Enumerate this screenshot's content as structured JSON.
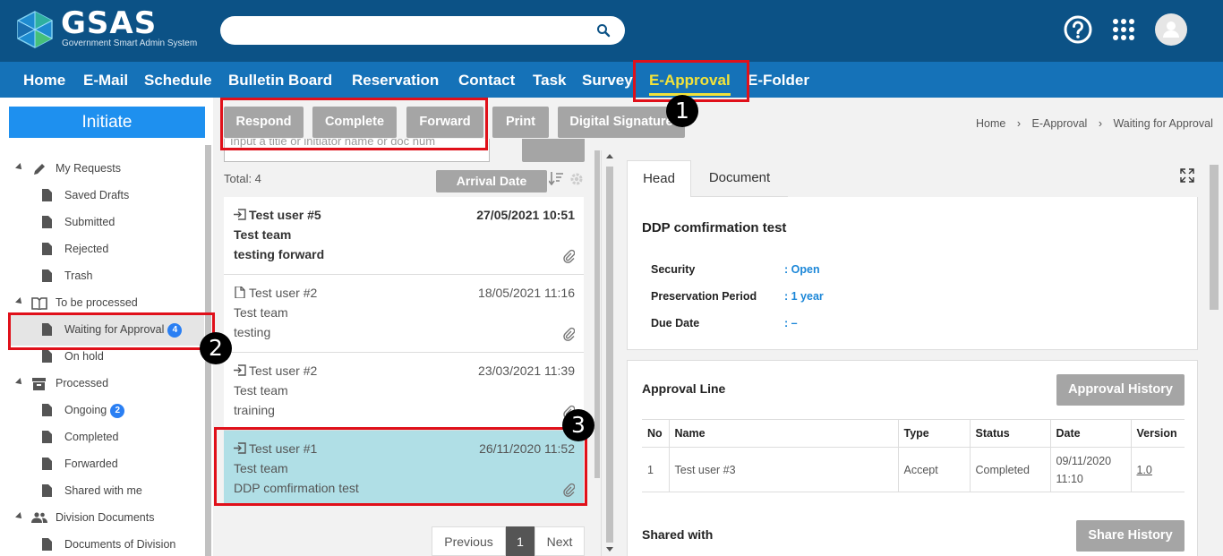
{
  "app": {
    "logo_text": "GSAS",
    "logo_subtitle": "Government Smart Admin System"
  },
  "header": {
    "search_placeholder": "",
    "icons": [
      "help-icon",
      "apps-grid-icon",
      "user-avatar-icon"
    ]
  },
  "nav": {
    "items": [
      "Home",
      "E-Mail",
      "Schedule",
      "Bulletin Board",
      "Reservation",
      "Contact",
      "Task",
      "Survey",
      "E-Approval",
      "E-Folder"
    ],
    "active": "E-Approval"
  },
  "sidebar": {
    "initiate_label": "Initiate",
    "groups": [
      {
        "label": "My Requests",
        "icon": "pencil-icon",
        "items": [
          {
            "label": "Saved Drafts"
          },
          {
            "label": "Submitted"
          },
          {
            "label": "Rejected"
          },
          {
            "label": "Trash"
          }
        ]
      },
      {
        "label": "To be processed",
        "icon": "book-icon",
        "items": [
          {
            "label": "Waiting for Approval",
            "count": "4"
          },
          {
            "label": "On hold"
          }
        ]
      },
      {
        "label": "Processed",
        "icon": "archive-box-icon",
        "items": [
          {
            "label": "Ongoing",
            "count": "2"
          },
          {
            "label": "Completed"
          },
          {
            "label": "Forwarded"
          },
          {
            "label": "Shared with me"
          }
        ]
      },
      {
        "label": "Division Documents",
        "icon": "people-icon",
        "items": [
          {
            "label": "Documents of Division"
          }
        ]
      }
    ]
  },
  "toolbar": {
    "respond": "Respond",
    "complete": "Complete",
    "forward": "Forward",
    "print": "Print",
    "digital_signature": "Digital Signature"
  },
  "breadcrumb": [
    "Home",
    "E-Approval",
    "Waiting for Approval"
  ],
  "list": {
    "search_placeholder": "Input a title or initiator name or doc num",
    "total": "Total: 4",
    "sort_label": "Arrival Date",
    "items": [
      {
        "sender": "Test user #5",
        "date": "27/05/2021 10:51",
        "team": "Test team",
        "title": "testing forward",
        "unread": true,
        "type": "inbox-icon"
      },
      {
        "sender": "Test user #2",
        "date": "18/05/2021 11:16",
        "team": "Test team",
        "title": "testing",
        "unread": false,
        "type": "document-icon"
      },
      {
        "sender": "Test user #2",
        "date": "23/03/2021 11:39",
        "team": "Test team",
        "title": "training",
        "unread": false,
        "type": "inbox-icon"
      },
      {
        "sender": "Test user #1",
        "date": "26/11/2020 11:52",
        "team": "Test team",
        "title": "DDP comfirmation test",
        "unread": false,
        "type": "inbox-icon",
        "selected": true
      }
    ],
    "pager": {
      "previous": "Previous",
      "page": "1",
      "next": "Next"
    }
  },
  "detail": {
    "tabs": [
      "Head",
      "Document"
    ],
    "active_tab": "Head",
    "title": "DDP comfirmation test",
    "fields": [
      {
        "key": "Security",
        "value": ": Open"
      },
      {
        "key": "Preservation Period",
        "value": ": 1 year"
      },
      {
        "key": "Due Date",
        "value": ":  –"
      }
    ],
    "approval_line_label": "Approval Line",
    "approval_history_label": "Approval History",
    "table": {
      "headers": [
        "No",
        "Name",
        "Type",
        "Status",
        "Date",
        "Version"
      ],
      "rows": [
        [
          "1",
          "Test user #3",
          "Accept",
          "Completed",
          "09/11/2020 11:10",
          "1.0"
        ]
      ]
    },
    "shared_with_label": "Shared with",
    "share_history_label": "Share History"
  },
  "annotations": [
    "1",
    "2",
    "3"
  ],
  "colors": {
    "header_bg": "#0c5286",
    "nav_bg": "#1572b8",
    "nav_active": "#f3e33a",
    "initiate_bg": "#1e90ef",
    "selected_row": "#b0dfe6",
    "highlight_box": "#e0101a",
    "link_value": "#1c87d8"
  }
}
